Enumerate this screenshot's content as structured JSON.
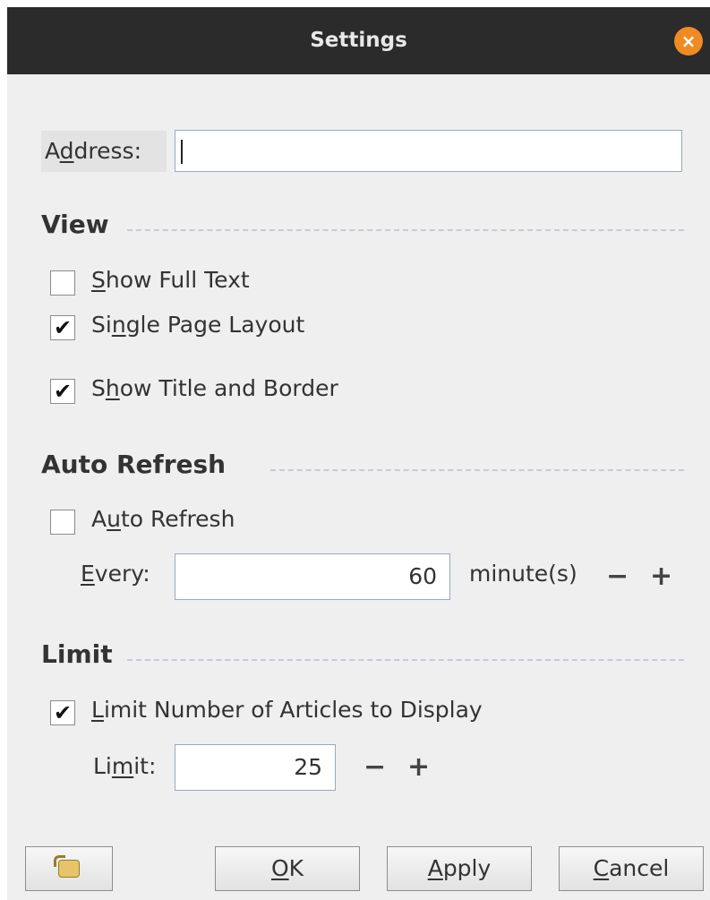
{
  "window": {
    "title": "Settings"
  },
  "address": {
    "label_pre": "A",
    "label_mn": "d",
    "label_post": "dress:",
    "value": ""
  },
  "view": {
    "heading": "View",
    "show_full_text": {
      "pre": "",
      "mn": "S",
      "post": "how Full Text",
      "checked": false
    },
    "single_page_layout": {
      "pre": "Si",
      "mn": "n",
      "post": "gle Page Layout",
      "checked": true
    },
    "show_title_border": {
      "pre": "S",
      "mn": "h",
      "post": "ow Title and Border",
      "checked": true
    }
  },
  "auto_refresh": {
    "heading": "Auto Refresh",
    "checkbox": {
      "pre": "A",
      "mn": "u",
      "post": "to Refresh",
      "checked": false
    },
    "every_label": {
      "pre": "",
      "mn": "E",
      "post": "very:"
    },
    "every_value": "60",
    "unit": "minute(s)",
    "minus": "−",
    "plus": "+"
  },
  "limit": {
    "heading": "Limit",
    "checkbox": {
      "pre": "",
      "mn": "L",
      "post": "imit Number of Articles to Display",
      "checked": true
    },
    "limit_label": {
      "pre": "Li",
      "mn": "m",
      "post": "it:"
    },
    "limit_value": "25",
    "minus": "−",
    "plus": "+"
  },
  "buttons": {
    "ok": {
      "pre": "",
      "mn": "O",
      "post": "K"
    },
    "apply": {
      "pre": "",
      "mn": "A",
      "post": "pply"
    },
    "cancel": {
      "pre": "",
      "mn": "C",
      "post": "ancel"
    }
  },
  "icons": {
    "close": "×",
    "check": "✔",
    "reset": "reset-icon"
  },
  "colors": {
    "titlebar": "#2b2b2b",
    "close": "#f08a22",
    "dialog": "#efefef"
  }
}
